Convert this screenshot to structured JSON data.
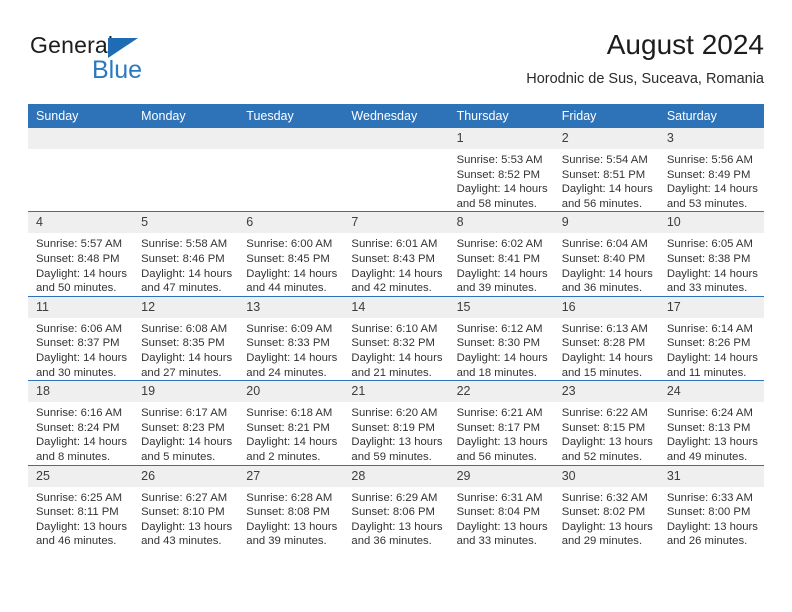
{
  "brand": {
    "name_top": "General",
    "name_bottom": "Blue",
    "triangle_color": "#1f6bb4",
    "blue_color": "#2a7ac0"
  },
  "header": {
    "month_title": "August 2024",
    "location": "Horodnic de Sus, Suceava, Romania"
  },
  "theme": {
    "header_blue": "#2e73b8",
    "daynum_band": "#efefef",
    "text": "#333333"
  },
  "weekday_headers": [
    "Sunday",
    "Monday",
    "Tuesday",
    "Wednesday",
    "Thursday",
    "Friday",
    "Saturday"
  ],
  "weeks": [
    [
      {
        "day": "",
        "sunrise": "",
        "sunset": "",
        "daylight_1": "",
        "daylight_2": ""
      },
      {
        "day": "",
        "sunrise": "",
        "sunset": "",
        "daylight_1": "",
        "daylight_2": ""
      },
      {
        "day": "",
        "sunrise": "",
        "sunset": "",
        "daylight_1": "",
        "daylight_2": ""
      },
      {
        "day": "",
        "sunrise": "",
        "sunset": "",
        "daylight_1": "",
        "daylight_2": ""
      },
      {
        "day": "1",
        "sunrise": "Sunrise: 5:53 AM",
        "sunset": "Sunset: 8:52 PM",
        "daylight_1": "Daylight: 14 hours",
        "daylight_2": "and 58 minutes."
      },
      {
        "day": "2",
        "sunrise": "Sunrise: 5:54 AM",
        "sunset": "Sunset: 8:51 PM",
        "daylight_1": "Daylight: 14 hours",
        "daylight_2": "and 56 minutes."
      },
      {
        "day": "3",
        "sunrise": "Sunrise: 5:56 AM",
        "sunset": "Sunset: 8:49 PM",
        "daylight_1": "Daylight: 14 hours",
        "daylight_2": "and 53 minutes."
      }
    ],
    [
      {
        "day": "4",
        "sunrise": "Sunrise: 5:57 AM",
        "sunset": "Sunset: 8:48 PM",
        "daylight_1": "Daylight: 14 hours",
        "daylight_2": "and 50 minutes."
      },
      {
        "day": "5",
        "sunrise": "Sunrise: 5:58 AM",
        "sunset": "Sunset: 8:46 PM",
        "daylight_1": "Daylight: 14 hours",
        "daylight_2": "and 47 minutes."
      },
      {
        "day": "6",
        "sunrise": "Sunrise: 6:00 AM",
        "sunset": "Sunset: 8:45 PM",
        "daylight_1": "Daylight: 14 hours",
        "daylight_2": "and 44 minutes."
      },
      {
        "day": "7",
        "sunrise": "Sunrise: 6:01 AM",
        "sunset": "Sunset: 8:43 PM",
        "daylight_1": "Daylight: 14 hours",
        "daylight_2": "and 42 minutes."
      },
      {
        "day": "8",
        "sunrise": "Sunrise: 6:02 AM",
        "sunset": "Sunset: 8:41 PM",
        "daylight_1": "Daylight: 14 hours",
        "daylight_2": "and 39 minutes."
      },
      {
        "day": "9",
        "sunrise": "Sunrise: 6:04 AM",
        "sunset": "Sunset: 8:40 PM",
        "daylight_1": "Daylight: 14 hours",
        "daylight_2": "and 36 minutes."
      },
      {
        "day": "10",
        "sunrise": "Sunrise: 6:05 AM",
        "sunset": "Sunset: 8:38 PM",
        "daylight_1": "Daylight: 14 hours",
        "daylight_2": "and 33 minutes."
      }
    ],
    [
      {
        "day": "11",
        "sunrise": "Sunrise: 6:06 AM",
        "sunset": "Sunset: 8:37 PM",
        "daylight_1": "Daylight: 14 hours",
        "daylight_2": "and 30 minutes."
      },
      {
        "day": "12",
        "sunrise": "Sunrise: 6:08 AM",
        "sunset": "Sunset: 8:35 PM",
        "daylight_1": "Daylight: 14 hours",
        "daylight_2": "and 27 minutes."
      },
      {
        "day": "13",
        "sunrise": "Sunrise: 6:09 AM",
        "sunset": "Sunset: 8:33 PM",
        "daylight_1": "Daylight: 14 hours",
        "daylight_2": "and 24 minutes."
      },
      {
        "day": "14",
        "sunrise": "Sunrise: 6:10 AM",
        "sunset": "Sunset: 8:32 PM",
        "daylight_1": "Daylight: 14 hours",
        "daylight_2": "and 21 minutes."
      },
      {
        "day": "15",
        "sunrise": "Sunrise: 6:12 AM",
        "sunset": "Sunset: 8:30 PM",
        "daylight_1": "Daylight: 14 hours",
        "daylight_2": "and 18 minutes."
      },
      {
        "day": "16",
        "sunrise": "Sunrise: 6:13 AM",
        "sunset": "Sunset: 8:28 PM",
        "daylight_1": "Daylight: 14 hours",
        "daylight_2": "and 15 minutes."
      },
      {
        "day": "17",
        "sunrise": "Sunrise: 6:14 AM",
        "sunset": "Sunset: 8:26 PM",
        "daylight_1": "Daylight: 14 hours",
        "daylight_2": "and 11 minutes."
      }
    ],
    [
      {
        "day": "18",
        "sunrise": "Sunrise: 6:16 AM",
        "sunset": "Sunset: 8:24 PM",
        "daylight_1": "Daylight: 14 hours",
        "daylight_2": "and 8 minutes."
      },
      {
        "day": "19",
        "sunrise": "Sunrise: 6:17 AM",
        "sunset": "Sunset: 8:23 PM",
        "daylight_1": "Daylight: 14 hours",
        "daylight_2": "and 5 minutes."
      },
      {
        "day": "20",
        "sunrise": "Sunrise: 6:18 AM",
        "sunset": "Sunset: 8:21 PM",
        "daylight_1": "Daylight: 14 hours",
        "daylight_2": "and 2 minutes."
      },
      {
        "day": "21",
        "sunrise": "Sunrise: 6:20 AM",
        "sunset": "Sunset: 8:19 PM",
        "daylight_1": "Daylight: 13 hours",
        "daylight_2": "and 59 minutes."
      },
      {
        "day": "22",
        "sunrise": "Sunrise: 6:21 AM",
        "sunset": "Sunset: 8:17 PM",
        "daylight_1": "Daylight: 13 hours",
        "daylight_2": "and 56 minutes."
      },
      {
        "day": "23",
        "sunrise": "Sunrise: 6:22 AM",
        "sunset": "Sunset: 8:15 PM",
        "daylight_1": "Daylight: 13 hours",
        "daylight_2": "and 52 minutes."
      },
      {
        "day": "24",
        "sunrise": "Sunrise: 6:24 AM",
        "sunset": "Sunset: 8:13 PM",
        "daylight_1": "Daylight: 13 hours",
        "daylight_2": "and 49 minutes."
      }
    ],
    [
      {
        "day": "25",
        "sunrise": "Sunrise: 6:25 AM",
        "sunset": "Sunset: 8:11 PM",
        "daylight_1": "Daylight: 13 hours",
        "daylight_2": "and 46 minutes."
      },
      {
        "day": "26",
        "sunrise": "Sunrise: 6:27 AM",
        "sunset": "Sunset: 8:10 PM",
        "daylight_1": "Daylight: 13 hours",
        "daylight_2": "and 43 minutes."
      },
      {
        "day": "27",
        "sunrise": "Sunrise: 6:28 AM",
        "sunset": "Sunset: 8:08 PM",
        "daylight_1": "Daylight: 13 hours",
        "daylight_2": "and 39 minutes."
      },
      {
        "day": "28",
        "sunrise": "Sunrise: 6:29 AM",
        "sunset": "Sunset: 8:06 PM",
        "daylight_1": "Daylight: 13 hours",
        "daylight_2": "and 36 minutes."
      },
      {
        "day": "29",
        "sunrise": "Sunrise: 6:31 AM",
        "sunset": "Sunset: 8:04 PM",
        "daylight_1": "Daylight: 13 hours",
        "daylight_2": "and 33 minutes."
      },
      {
        "day": "30",
        "sunrise": "Sunrise: 6:32 AM",
        "sunset": "Sunset: 8:02 PM",
        "daylight_1": "Daylight: 13 hours",
        "daylight_2": "and 29 minutes."
      },
      {
        "day": "31",
        "sunrise": "Sunrise: 6:33 AM",
        "sunset": "Sunset: 8:00 PM",
        "daylight_1": "Daylight: 13 hours",
        "daylight_2": "and 26 minutes."
      }
    ]
  ]
}
